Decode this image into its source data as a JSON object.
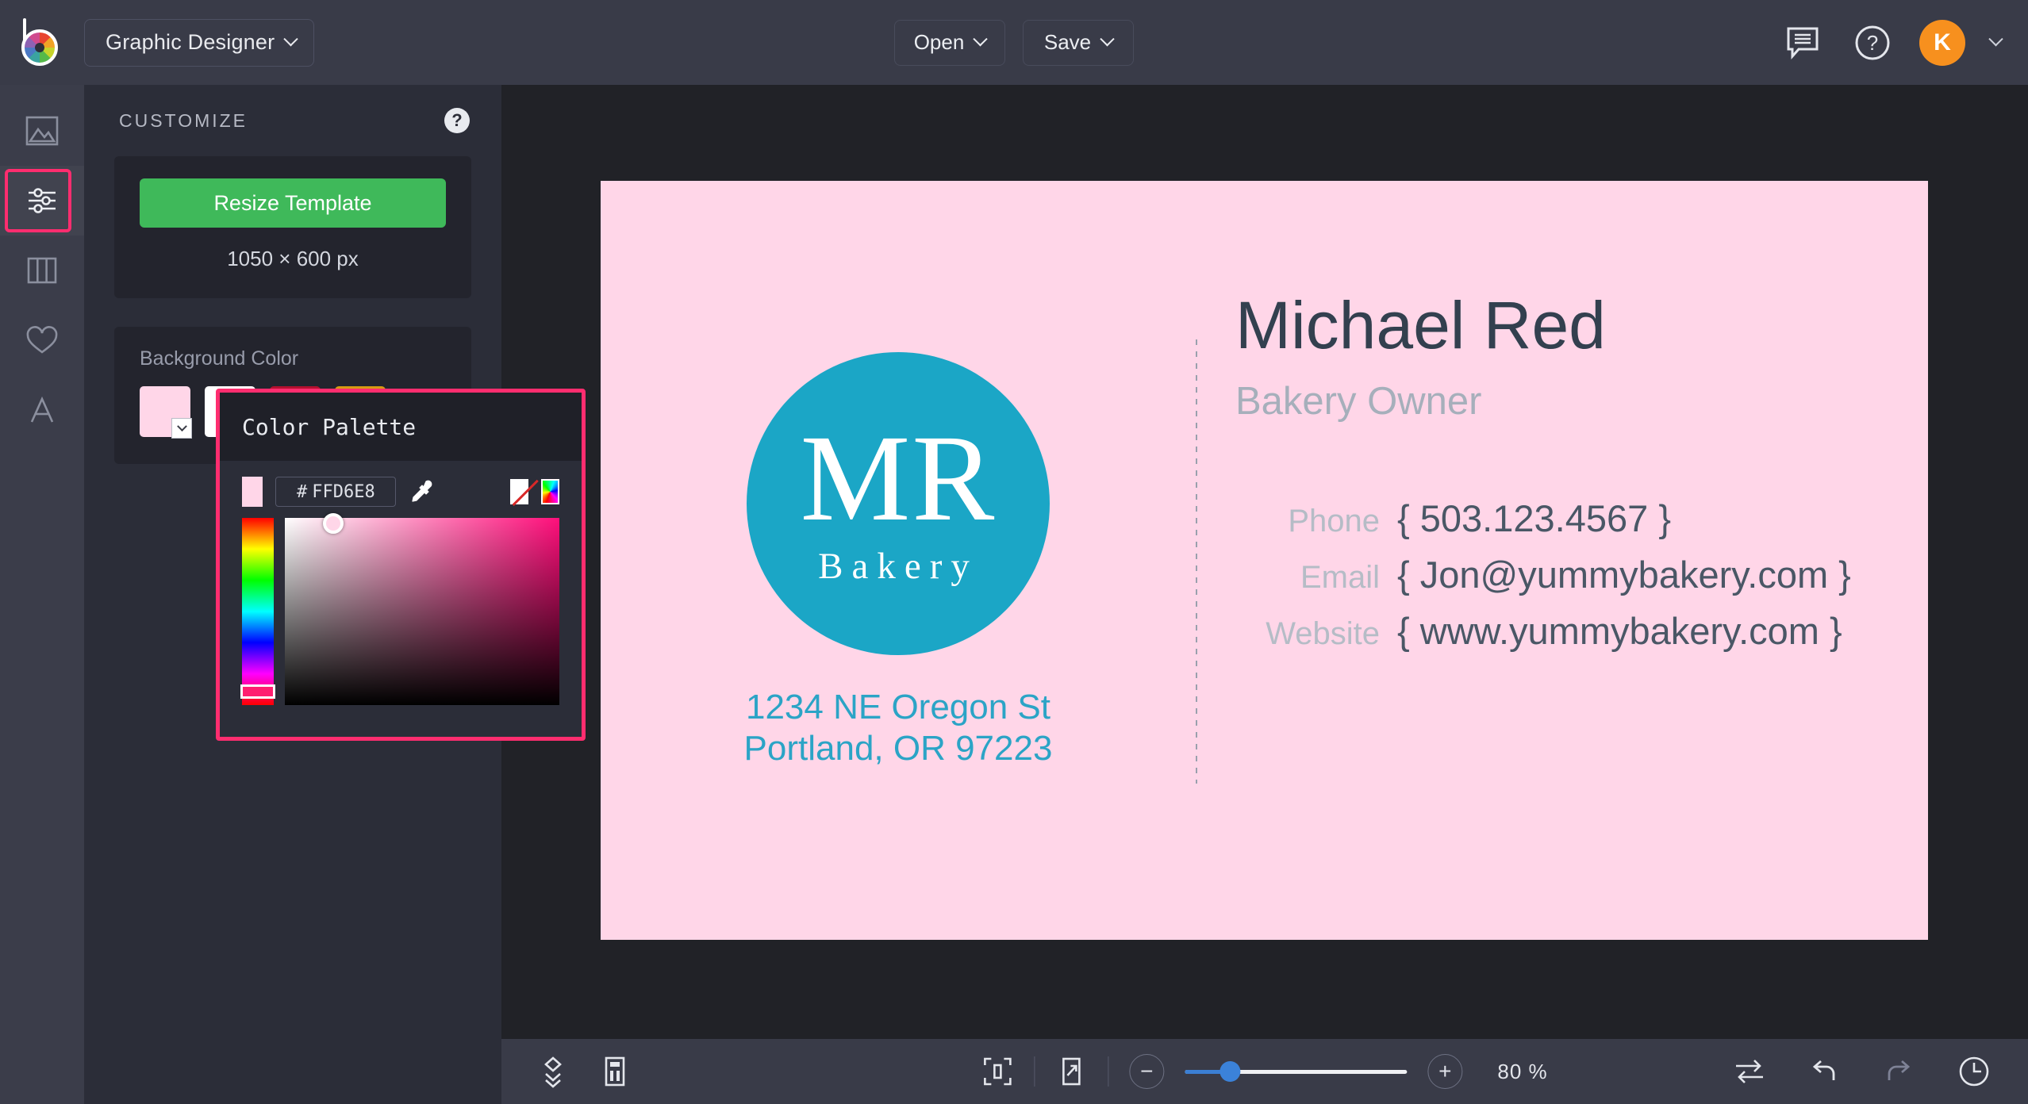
{
  "app": {
    "logo_name": "befunky-logo",
    "tool_selector": "Graphic Designer"
  },
  "topbar": {
    "open_label": "Open",
    "save_label": "Save",
    "feedback_icon": "speech-bubble-icon",
    "help_icon": "question-circle-icon",
    "avatar_initial": "K"
  },
  "rail": {
    "items": [
      {
        "name": "image-icon",
        "label": "Image"
      },
      {
        "name": "sliders-icon",
        "label": "Customize",
        "active": true
      },
      {
        "name": "columns-icon",
        "label": "Templates"
      },
      {
        "name": "heart-icon",
        "label": "Favorites"
      },
      {
        "name": "text-a-icon",
        "label": "Text"
      }
    ]
  },
  "panel": {
    "title": "CUSTOMIZE",
    "help_icon": "question-mark-icon",
    "resize_label": "Resize Template",
    "dimensions": "1050 × 600 px",
    "background_color_label": "Background Color",
    "swatches": [
      {
        "name": "swatch-pink",
        "color": "#FFD6E8",
        "selected": true
      },
      {
        "name": "swatch-white",
        "color": "#FFFFFF",
        "selected": false
      },
      {
        "name": "swatch-crimson",
        "color": "#B4102F",
        "selected": false
      },
      {
        "name": "swatch-amber",
        "color": "#D69B12",
        "selected": false
      }
    ]
  },
  "palette": {
    "title": "Color Palette",
    "hex_prefix": "#",
    "hex_value": "FFD6E8",
    "preview_color": "#FFD6E8",
    "eyedropper_icon": "eyedropper-icon",
    "no_color_icon": "no-color-icon",
    "color_wheel_icon": "color-wheel-icon",
    "hue_handle_color": "#FF1F70"
  },
  "canvas": {
    "card_background": "#FFD6E8",
    "logo": {
      "circle_color": "#1BA6C6",
      "initials": "MR",
      "subtitle": "Bakery"
    },
    "address_line1": "1234 NE Oregon St",
    "address_line2": "Portland, OR 97223",
    "address_color": "#2BA4C6",
    "name": "Michael Red",
    "role": "Bakery Owner",
    "contacts": [
      {
        "label": "Phone",
        "value": "{ 503.123.4567 }"
      },
      {
        "label": "Email",
        "value": "{ Jon@yummybakery.com }"
      },
      {
        "label": "Website",
        "value": "{ www.yummybakery.com }"
      }
    ]
  },
  "bottombar": {
    "layers_icon": "layers-icon",
    "panel_icon": "panel-layout-icon",
    "fit_icon": "fit-to-screen-icon",
    "expand_icon": "expand-arrow-icon",
    "zoom_out_label": "−",
    "zoom_in_label": "+",
    "zoom_value": "80 %",
    "zoom_percent": 80,
    "compare_icon": "compare-swap-icon",
    "undo_icon": "undo-icon",
    "redo_icon": "redo-icon",
    "history_icon": "history-clock-icon"
  }
}
